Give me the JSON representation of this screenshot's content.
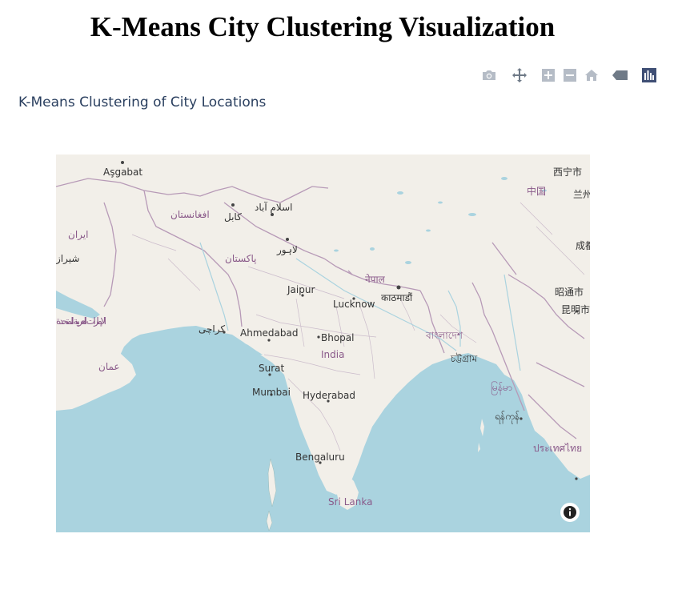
{
  "page": {
    "title": "K-Means City Clustering Visualization"
  },
  "plot": {
    "title": "K-Means Clustering of City Locations"
  },
  "modebar": {
    "buttons": [
      {
        "name": "camera-icon"
      },
      {
        "name": "pan-icon"
      },
      {
        "name": "zoom-in-icon"
      },
      {
        "name": "zoom-out-icon"
      },
      {
        "name": "home-icon"
      },
      {
        "name": "toggle-hover-icon"
      },
      {
        "name": "plotly-logo-icon"
      }
    ]
  },
  "map": {
    "base": "OpenStreetMap",
    "colors": {
      "water": "#aad3df",
      "land": "#f2efe9",
      "border": "#b79ab7"
    },
    "labels": {
      "asgabat": "Aşgabat",
      "afghanistan": "افغانستان",
      "kabul": "کابل",
      "islamabad": "اسلام آباد",
      "iran": "ایران",
      "shiraz": "شیراز",
      "pakistan": "پاکستان",
      "lahore": "لاہور",
      "uae": "الإمارات العربية المتحدة",
      "oman": "عمان",
      "karachi": "کراچی",
      "jaipur": "Jaipur",
      "lucknow": "Lucknow",
      "nepal": "नेपाल",
      "kathmandu": "काठमाडौं",
      "ahmedabad": "Ahmedabad",
      "bhopal": "Bhopal",
      "india": "India",
      "surat": "Surat",
      "mumbai": "Mumbai",
      "hyderabad": "Hyderabad",
      "bengaluru": "Bengaluru",
      "srilanka": "Sri Lanka",
      "bangladesh": "বাংলাদেশ",
      "chittagong": "চট্টগ্রাম",
      "myanmar": "မြန်မာ",
      "yangon": "ရန်ကုန်",
      "thailand": "ประเทศไทย",
      "china": "中国",
      "xining": "西宁市",
      "lanzhou": "兰州",
      "chengdu": "成都",
      "zhaotong": "昭通市",
      "kunming": "昆明市"
    }
  }
}
